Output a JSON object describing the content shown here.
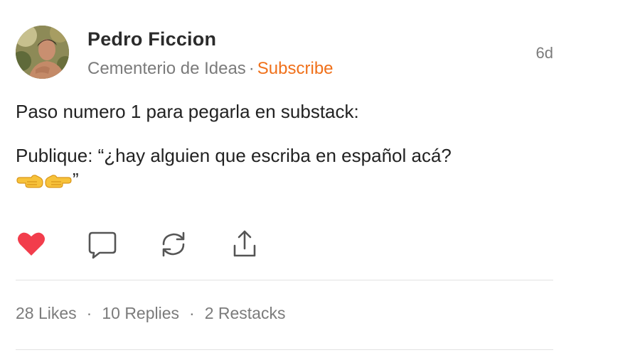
{
  "author": {
    "name": "Pedro Ficcion",
    "publication": "Cementerio de Ideas",
    "separator": "·",
    "subscribe_label": "Subscribe"
  },
  "post": {
    "timestamp": "6d",
    "paragraph_1": "Paso numero 1 para pegarla en substack:",
    "paragraph_2": "Publique: “¿hay alguien que escriba en español acá?",
    "paragraph_2_end": "”"
  },
  "actions": {
    "like_icon": "heart-icon",
    "reply_icon": "comment-icon",
    "restack_icon": "restack-icon",
    "share_icon": "share-icon",
    "like_color": "#f23d4c"
  },
  "stats": {
    "likes": "28 Likes",
    "replies": "10 Replies",
    "restacks": "2 Restacks",
    "separator": "·"
  },
  "colors": {
    "accent": "#f0701a",
    "muted_text": "#7b7b7b",
    "divider": "#e3e3e3"
  }
}
